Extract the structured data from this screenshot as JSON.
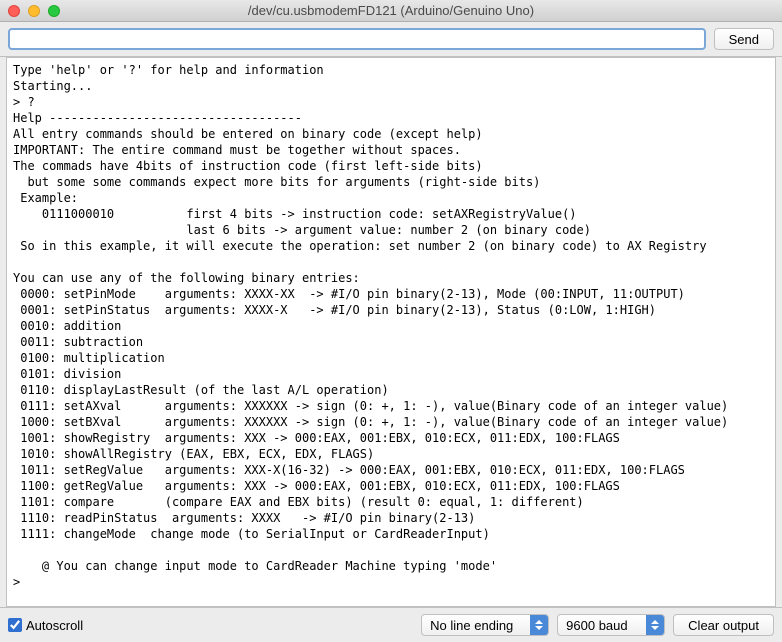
{
  "window": {
    "title": "/dev/cu.usbmodemFD121 (Arduino/Genuino Uno)"
  },
  "toolbar": {
    "input_value": "",
    "send_label": "Send"
  },
  "console": {
    "text": "Type 'help' or '?' for help and information\nStarting...\n> ?\nHelp -----------------------------------\nAll entry commands should be entered on binary code (except help)\nIMPORTANT: The entire command must be together without spaces.\nThe commads have 4bits of instruction code (first left-side bits)\n  but some some commands expect more bits for arguments (right-side bits)\n Example:\n    0111000010          first 4 bits -> instruction code: setAXRegistryValue()\n                        last 6 bits -> argument value: number 2 (on binary code)\n So in this example, it will execute the operation: set number 2 (on binary code) to AX Registry\n\nYou can use any of the following binary entries:\n 0000: setPinMode    arguments: XXXX-XX  -> #I/O pin binary(2-13), Mode (00:INPUT, 11:OUTPUT)\n 0001: setPinStatus  arguments: XXXX-X   -> #I/O pin binary(2-13), Status (0:LOW, 1:HIGH)\n 0010: addition\n 0011: subtraction\n 0100: multiplication\n 0101: division\n 0110: displayLastResult (of the last A/L operation)\n 0111: setAXval      arguments: XXXXXX -> sign (0: +, 1: -), value(Binary code of an integer value)\n 1000: setBXval      arguments: XXXXXX -> sign (0: +, 1: -), value(Binary code of an integer value)\n 1001: showRegistry  arguments: XXX -> 000:EAX, 001:EBX, 010:ECX, 011:EDX, 100:FLAGS\n 1010: showAllRegistry (EAX, EBX, ECX, EDX, FLAGS)\n 1011: setRegValue   arguments: XXX-X(16-32) -> 000:EAX, 001:EBX, 010:ECX, 011:EDX, 100:FLAGS\n 1100: getRegValue   arguments: XXX -> 000:EAX, 001:EBX, 010:ECX, 011:EDX, 100:FLAGS\n 1101: compare       (compare EAX and EBX bits) (result 0: equal, 1: different)\n 1110: readPinStatus  arguments: XXXX   -> #I/O pin binary(2-13)\n 1111: changeMode  change mode (to SerialInput or CardReaderInput)\n\n    @ You can change input mode to CardReader Machine typing 'mode'\n>"
  },
  "bottombar": {
    "autoscroll_label": "Autoscroll",
    "autoscroll_checked": true,
    "line_ending_label": "No line ending",
    "baud_label": "9600 baud",
    "clear_label": "Clear output"
  }
}
